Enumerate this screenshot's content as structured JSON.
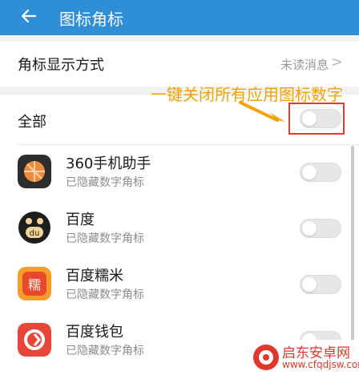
{
  "header": {
    "title": "图标角标"
  },
  "setting": {
    "label": "角标显示方式",
    "value": "未读消息",
    "chevron": ">"
  },
  "all": {
    "label": "全部",
    "toggle": "off"
  },
  "apps": [
    {
      "name": "360手机助手",
      "sub": "已隐藏数字角标",
      "icon": "360-assistant-icon",
      "toggle": "off"
    },
    {
      "name": "百度",
      "sub": "已隐藏数字角标",
      "icon": "baidu-icon",
      "toggle": "off"
    },
    {
      "name": "百度糯米",
      "sub": "已隐藏数字角标",
      "icon": "baidu-nuomi-icon",
      "icon_text": "糯",
      "toggle": "off"
    },
    {
      "name": "百度钱包",
      "sub": "已隐藏数字角标",
      "icon": "baidu-wallet-icon",
      "toggle": "off"
    }
  ],
  "annotation": {
    "text": "一键关闭所有应用图标数字"
  },
  "watermark": {
    "title": "启东安卓网",
    "url": "www.cfqdjsw.com"
  },
  "colors": {
    "header": "#2f8fd6",
    "annotation_text": "#f5a100",
    "annotation_box": "#e53b2e"
  }
}
